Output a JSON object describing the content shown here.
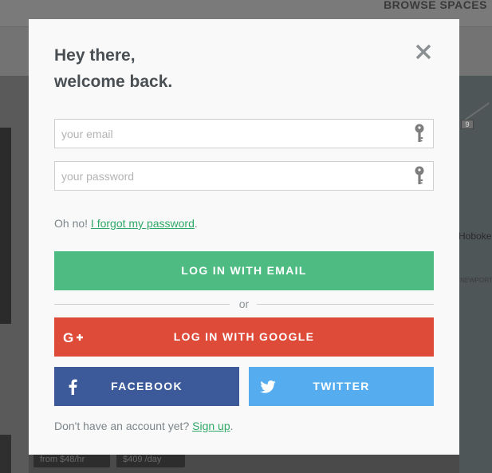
{
  "background": {
    "nav_link": "BROWSE SPACES",
    "map_badge": "9",
    "map_label_hoboken": "Hoboke",
    "map_label_newport": "NEWPORT",
    "price_tags": [
      "from $48/hr",
      "$409 /day"
    ]
  },
  "modal": {
    "title_line1": "Hey there,",
    "title_line2": "welcome back.",
    "email_placeholder": "your email",
    "password_placeholder": "your password",
    "forgot_prefix": "Oh no!",
    "forgot_link": "I forgot my password",
    "forgot_suffix": ".",
    "login_email_label": "LOG IN WITH EMAIL",
    "divider_label": "or",
    "login_google_label": "LOG IN WITH GOOGLE",
    "facebook_label": "FACEBOOK",
    "twitter_label": "TWITTER",
    "signup_prefix": "Don't have an account yet?",
    "signup_link": "Sign up",
    "signup_suffix": "."
  },
  "colors": {
    "email_button": "#4dbb82",
    "google_button": "#de4b39",
    "facebook_button": "#3c5a9a",
    "twitter_button": "#55acee",
    "link": "#2fa866"
  },
  "icons": [
    "close-icon",
    "key-icon",
    "google-plus-icon",
    "facebook-icon",
    "twitter-icon"
  ]
}
